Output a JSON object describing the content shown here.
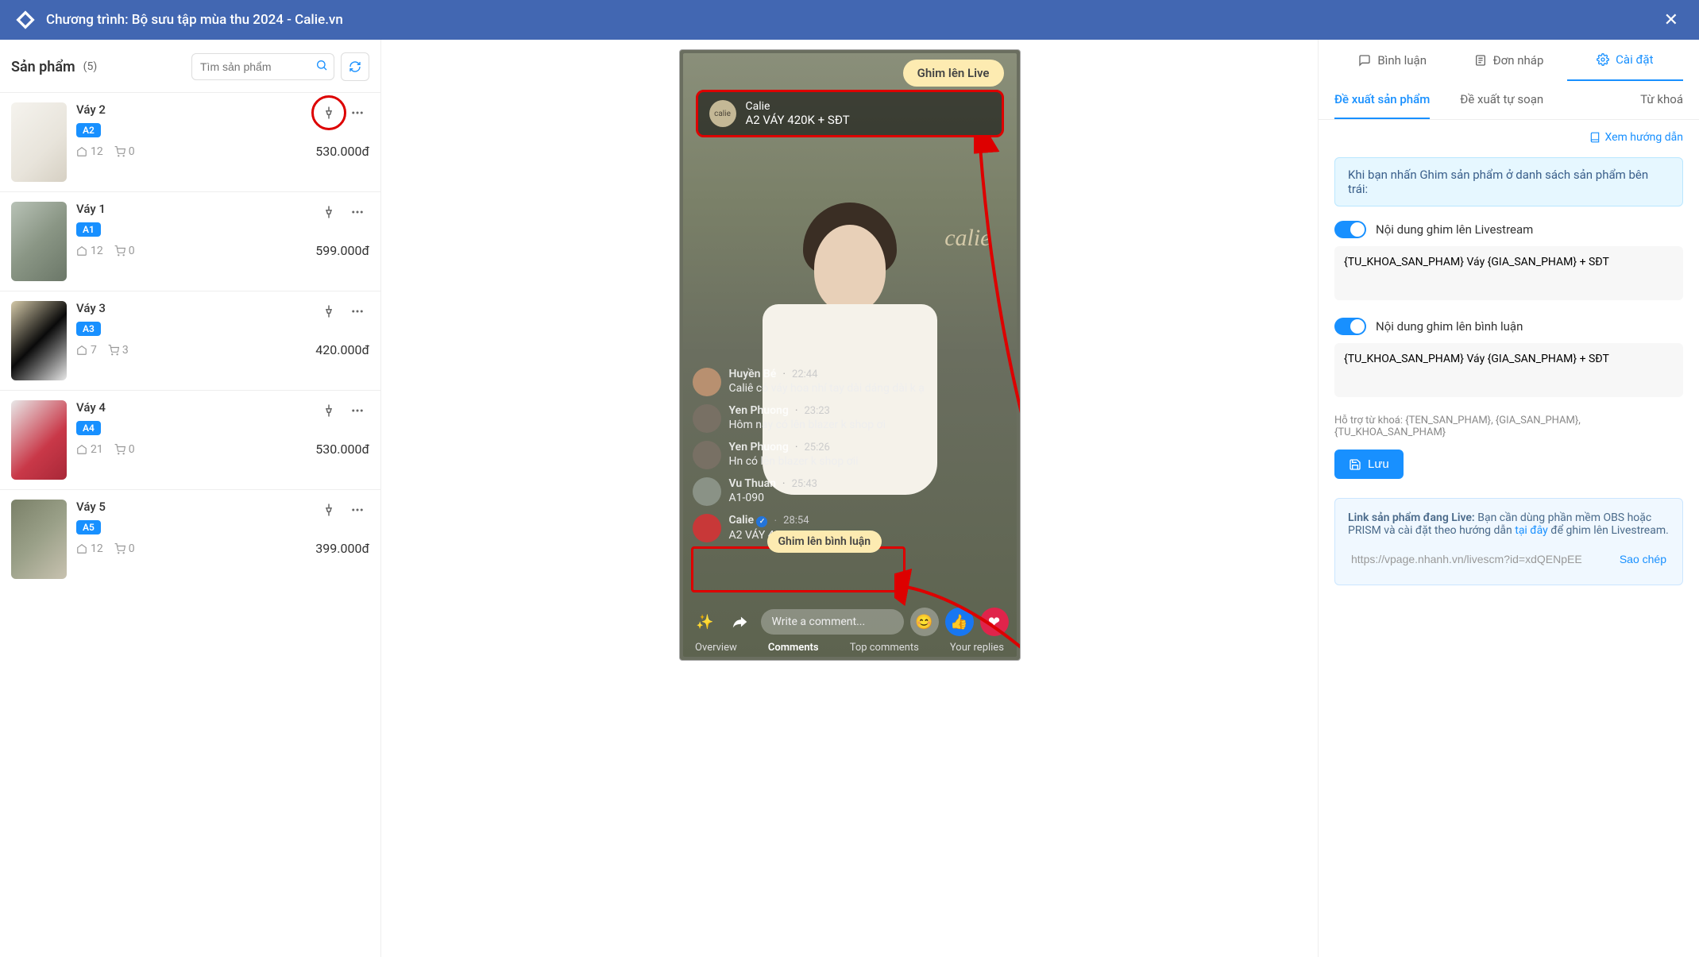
{
  "header": {
    "title": "Chương trình: Bộ sưu tập mùa thu 2024 - Calie.vn"
  },
  "left": {
    "title": "Sản phẩm",
    "count": "(5)",
    "searchPlaceholder": "Tìm sản phẩm"
  },
  "products": [
    {
      "name": "Váy 2",
      "badge": "A2",
      "home": "12",
      "cart": "0",
      "price": "530.000đ",
      "halo": true
    },
    {
      "name": "Váy 1",
      "badge": "A1",
      "home": "12",
      "cart": "0",
      "price": "599.000đ",
      "halo": false
    },
    {
      "name": "Váy 3",
      "badge": "A3",
      "home": "7",
      "cart": "3",
      "price": "420.000đ",
      "halo": false
    },
    {
      "name": "Váy 4",
      "badge": "A4",
      "home": "21",
      "cart": "0",
      "price": "530.000đ",
      "halo": false
    },
    {
      "name": "Váy 5",
      "badge": "A5",
      "home": "12",
      "cart": "0",
      "price": "399.000đ",
      "halo": false
    }
  ],
  "live": {
    "labelTop": "Ghim lên Live",
    "pinName": "Calie",
    "pinMsg": "A2 VÁY 420K + SĐT",
    "wallText": "calie",
    "labelCmt": "Ghim lên bình luận",
    "inputPlaceholder": "Write a comment...",
    "tabs": [
      "Overview",
      "Comments",
      "Top comments",
      "Your replies"
    ],
    "comments": [
      {
        "name": "Huyền Bé",
        "time": "22:44",
        "text": "Caliê có váy hoa nhí tay dài dáng dài k ạ",
        "av": "#b89070"
      },
      {
        "name": "Yen Phuong",
        "time": "23:23",
        "text": "Hôm nay có lên blazer k shop ơi",
        "av": "#787064"
      },
      {
        "name": "Yen Phuong",
        "time": "25:26",
        "text": "Hn có lên blazer k shop ơii",
        "av": "#787064"
      },
      {
        "name": "Vu Thuan",
        "time": "25:43",
        "text": "A1-090",
        "av": "#8a9286"
      },
      {
        "name": "Calie",
        "time": "28:54",
        "text": "A2 VÁY 420K + SĐT",
        "av": "#c83838",
        "verified": true
      }
    ]
  },
  "right": {
    "tabs": {
      "comment": "Bình luận",
      "draft": "Đơn nháp",
      "settings": "Cài đặt"
    },
    "subtabs": {
      "suggest": "Đề xuất sản phẩm",
      "auto": "Đề xuất tự soạn",
      "keyword": "Từ khoá"
    },
    "guide": "Xem hướng dẫn",
    "info": "Khi bạn nhấn Ghim sản phẩm ở danh sách sản phẩm bên trái:",
    "toggle1": "Nội dung ghim lên Livestream",
    "ta1": "{TU_KHOA_SAN_PHAM} Váy {GIA_SAN_PHAM} + SĐT",
    "toggle2": "Nội dung ghim lên bình luận",
    "ta2": "{TU_KHOA_SAN_PHAM} Váy {GIA_SAN_PHAM} + SĐT",
    "hint": "Hỗ trợ từ khoá: {TEN_SAN_PHAM}, {GIA_SAN_PHAM}, {TU_KHOA_SAN_PHAM}",
    "save": "Lưu",
    "linkLabel": "Link sản phẩm đang Live:",
    "linkText1": "Bạn cần dùng phần mềm OBS hoặc PRISM và cài đặt theo hướng dẫn ",
    "linkHere": "tại đây",
    "linkText2": " để ghim lên Livestream.",
    "linkUrl": "https://vpage.nhanh.vn/livescm?id=xdQENpEE",
    "copy": "Sao chép"
  }
}
